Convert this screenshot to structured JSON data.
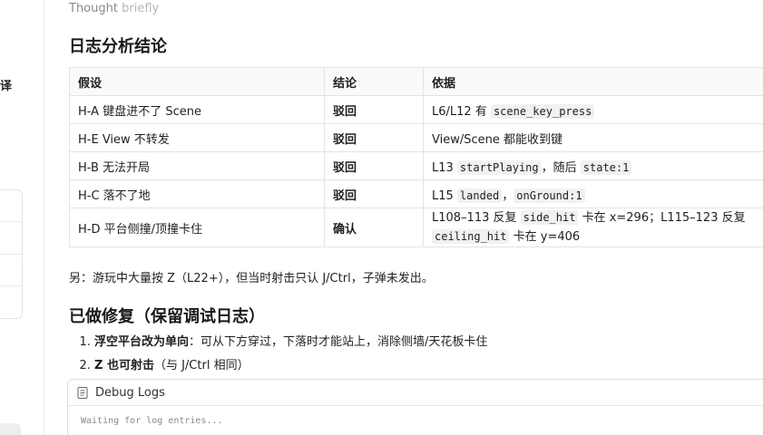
{
  "thought": {
    "label": "Thought",
    "detail": "briefly"
  },
  "sidebar": {
    "label_char": "译"
  },
  "log_section": {
    "title": "日志分析结论",
    "headers": [
      "假设",
      "结论",
      "依据"
    ],
    "rows": [
      {
        "hypothesis": "H-A 键盘进不了 Scene",
        "verdict": "驳回",
        "evidence": [
          {
            "t": "L6/L12 有 "
          },
          {
            "c": "scene_key_press"
          }
        ]
      },
      {
        "hypothesis": "H-E View 不转发",
        "verdict": "驳回",
        "evidence": [
          {
            "t": "View/Scene 都能收到键"
          }
        ]
      },
      {
        "hypothesis": "H-B 无法开局",
        "verdict": "驳回",
        "evidence": [
          {
            "t": "L13 "
          },
          {
            "c": "startPlaying"
          },
          {
            "t": "，随后 "
          },
          {
            "c": "state:1"
          }
        ]
      },
      {
        "hypothesis": "H-C 落不了地",
        "verdict": "驳回",
        "evidence": [
          {
            "t": "L15 "
          },
          {
            "c": "landed"
          },
          {
            "t": "，"
          },
          {
            "c": "onGround:1"
          }
        ]
      },
      {
        "hypothesis": "H-D 平台侧撞/顶撞卡住",
        "verdict": "确认",
        "evidence": [
          {
            "t": "L108–113 反复 "
          },
          {
            "c": "side_hit"
          },
          {
            "t": " 卡在 x=296；L115–123 反复 "
          },
          {
            "c": "ceiling_hit"
          },
          {
            "t": " 卡在 y=406"
          }
        ]
      }
    ]
  },
  "note": "另：游玩中大量按 Z（L22+），但当时射击只认 J/Ctrl，子弹未发出。",
  "fix_section": {
    "title": "已做修复（保留调试日志）",
    "items": [
      {
        "bold": "浮空平台改为单向",
        "rest": "：可从下方穿过，下落时才能站上，消除侧墙/天花板卡住"
      },
      {
        "bold": "Z 也可射击",
        "rest": "（与 J/Ctrl 相同）"
      }
    ]
  },
  "debug": {
    "title": "Debug Logs",
    "placeholder": "Waiting for log entries..."
  }
}
